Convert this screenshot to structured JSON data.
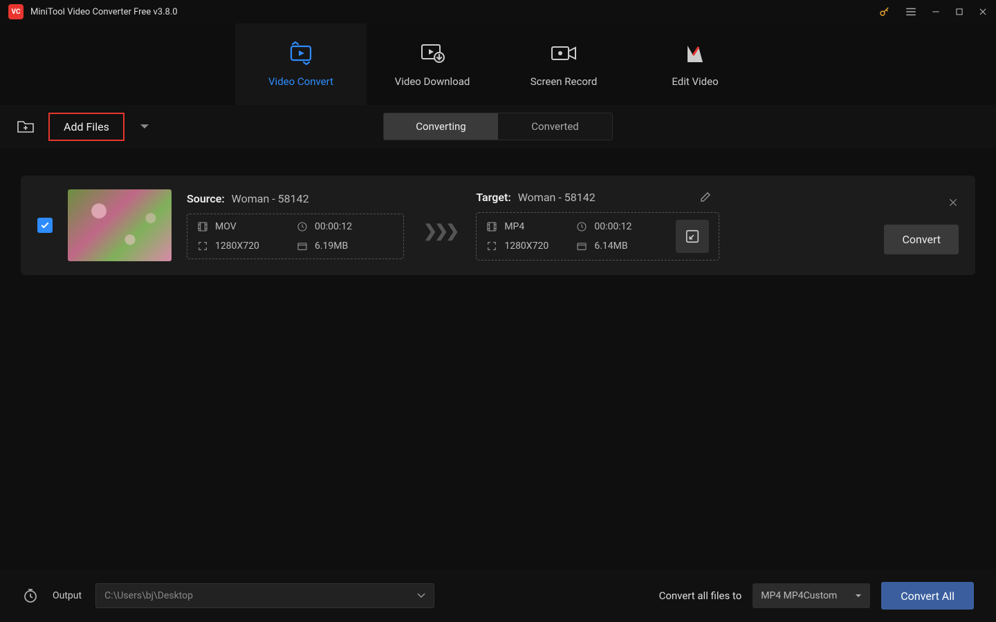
{
  "title": "MiniTool Video Converter Free v3.8.0",
  "nav": {
    "convert": "Video Convert",
    "download": "Video Download",
    "record": "Screen Record",
    "edit": "Edit Video"
  },
  "toolbar": {
    "add_files": "Add Files",
    "tab_converting": "Converting",
    "tab_converted": "Converted"
  },
  "item": {
    "source_label": "Source:",
    "source_name": "Woman - 58142",
    "source_format": "MOV",
    "source_duration": "00:00:12",
    "source_resolution": "1280X720",
    "source_size": "6.19MB",
    "target_label": "Target:",
    "target_name": "Woman - 58142",
    "target_format": "MP4",
    "target_duration": "00:00:12",
    "target_resolution": "1280X720",
    "target_size": "6.14MB",
    "convert": "Convert"
  },
  "footer": {
    "output_label": "Output",
    "output_path": "C:\\Users\\bj\\Desktop",
    "convert_all_label": "Convert all files to",
    "format": "MP4 MP4Custom",
    "convert_all": "Convert All"
  }
}
